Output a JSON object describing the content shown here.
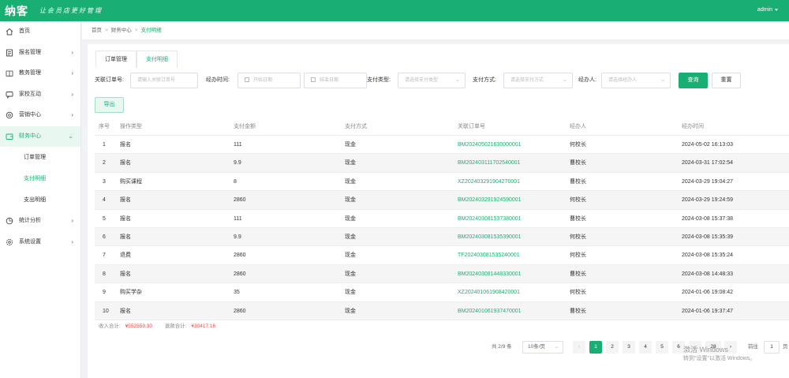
{
  "app": {
    "logo": "纳客",
    "slogan": "让会员店更好管理",
    "user": "admin"
  },
  "colors": {
    "brand": "#1aaf72",
    "money_red": "#e84c4c"
  },
  "sidebar": {
    "items": [
      {
        "label": "首页",
        "icon": "home-icon",
        "has_arrow": false
      },
      {
        "label": "报名管理",
        "icon": "list-icon",
        "has_arrow": true
      },
      {
        "label": "教务管理",
        "icon": "book-icon",
        "has_arrow": true
      },
      {
        "label": "家校互动",
        "icon": "chat-icon",
        "has_arrow": true
      },
      {
        "label": "营销中心",
        "icon": "gift-icon",
        "has_arrow": true
      },
      {
        "label": "财务中心",
        "icon": "wallet-icon",
        "has_arrow": true,
        "open": true
      },
      {
        "label": "统计分析",
        "icon": "chart-icon",
        "has_arrow": true
      },
      {
        "label": "系统设置",
        "icon": "gear-icon",
        "has_arrow": true
      }
    ],
    "sub_items": [
      {
        "label": "订单管理",
        "active": false
      },
      {
        "label": "支付明细",
        "active": true
      },
      {
        "label": "支出明细",
        "active": false
      }
    ]
  },
  "breadcrumb": [
    "首页",
    "财务中心",
    "支付明细"
  ],
  "tabs": [
    {
      "label": "订单管理",
      "active": false
    },
    {
      "label": "支付明细",
      "active": true
    }
  ],
  "filters": {
    "order_no_label": "关联订单号:",
    "order_no_placeholder": "请输入关联订单号",
    "time_label": "经办时间:",
    "start_placeholder": "开始日期",
    "end_placeholder": "结束日期",
    "pay_type_label": "支付类型:",
    "pay_type_placeholder": "请选择支付类型",
    "pay_method_label": "支付方式:",
    "pay_method_placeholder": "请选择支付方式",
    "handler_label": "经办人:",
    "handler_placeholder": "请选择经办人",
    "query_button": "查询",
    "reset_button": "重置",
    "export_button": "导出"
  },
  "table": {
    "headers": [
      "序号",
      "操作类型",
      "支付金额",
      "支付方式",
      "关联订单号",
      "经办人",
      "经办时间"
    ],
    "rows": [
      [
        "1",
        "报名",
        "111",
        "现金",
        "BM202405021630000001",
        "何校长",
        "2024-05-02 16:13:03"
      ],
      [
        "2",
        "报名",
        "9.9",
        "现金",
        "BM202403111702540001",
        "曹校长",
        "2024-03-31 17:02:54"
      ],
      [
        "3",
        "购买课程",
        "8",
        "现金",
        "XZ202403291904270001",
        "曹校长",
        "2024-03-29 19:04:27"
      ],
      [
        "4",
        "报名",
        "2860",
        "现金",
        "BM202403291924590001",
        "何校长",
        "2024-03-29 19:24:59"
      ],
      [
        "5",
        "报名",
        "111",
        "现金",
        "BM202403081537380001",
        "曹校长",
        "2024-03-08 15:37:38"
      ],
      [
        "6",
        "报名",
        "9.9",
        "现金",
        "BM202403081535390001",
        "何校长",
        "2024-03-08 15:35:39"
      ],
      [
        "7",
        "退费",
        "2860",
        "现金",
        "TF202403081535240001",
        "何校长",
        "2024-03-08 15:35:24"
      ],
      [
        "8",
        "报名",
        "2860",
        "现金",
        "BM202403081448330001",
        "曹校长",
        "2024-03-08 14:48:33"
      ],
      [
        "9",
        "购买学杂",
        "35",
        "现金",
        "XZ202401061908420001",
        "何校长",
        "2024-01-06 19:08:42"
      ],
      [
        "10",
        "报名",
        "2860",
        "现金",
        "BM202401061937470001",
        "曹校长",
        "2024-01-06 19:37:47"
      ]
    ]
  },
  "summary": {
    "income_label": "收入合计:",
    "income_value": "¥552559.30",
    "refund_label": "退款合计:",
    "refund_value": "¥30417.16"
  },
  "pagination": {
    "total_text": "共 2/9 条",
    "page_size": "10条/页",
    "pages": [
      "1",
      "2",
      "3",
      "4",
      "5",
      "6",
      "28"
    ],
    "current": "1",
    "goto_label": "前往",
    "goto_value": "1",
    "goto_suffix": "页"
  },
  "watermark": {
    "line1": "激活 Windows",
    "line2": "转到\"设置\"以激活 Windows。"
  }
}
